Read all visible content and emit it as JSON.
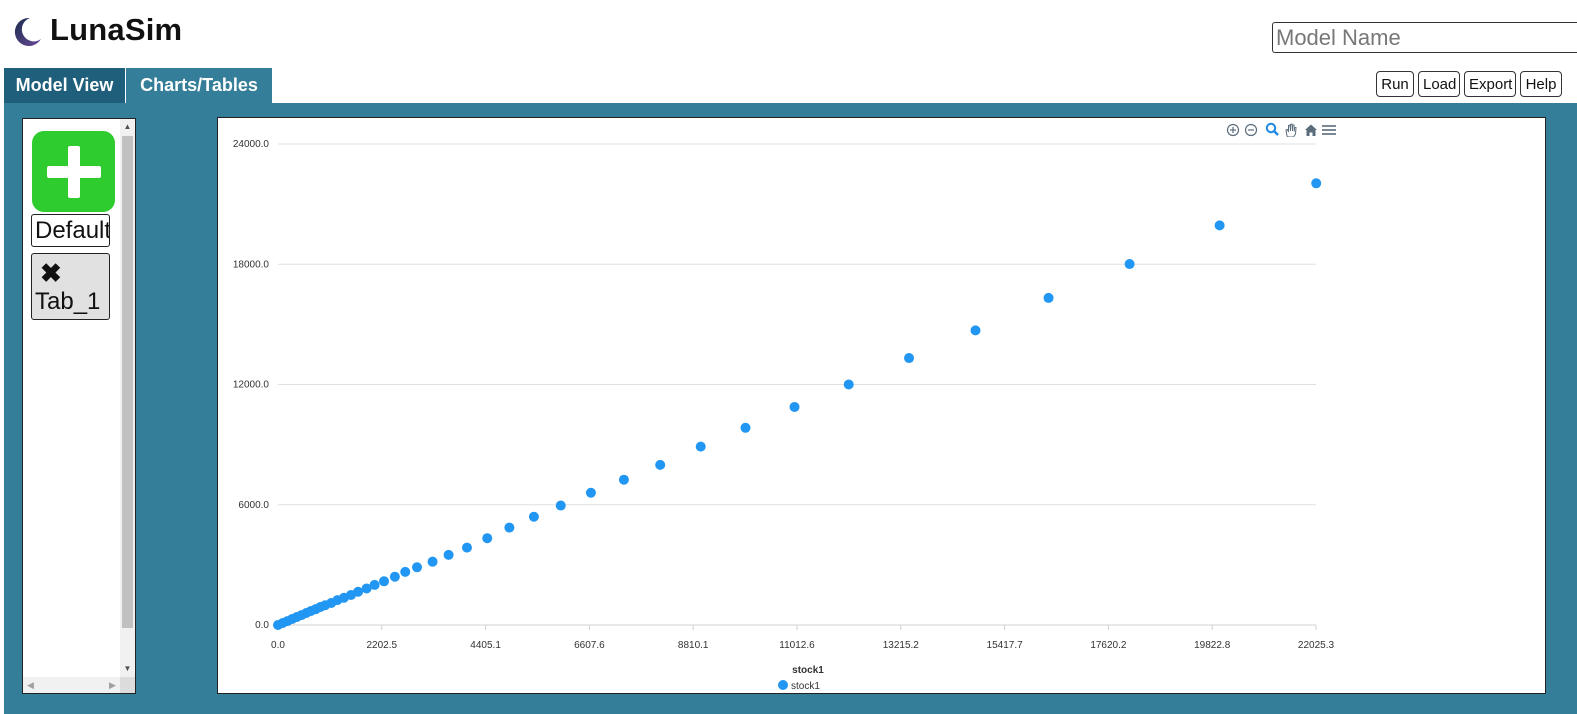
{
  "app": {
    "title": "LunaSim",
    "logo_icon": "crescent-moon-icon",
    "model_name_placeholder": "Model Name"
  },
  "tabs": [
    {
      "label": "Model View",
      "active": false
    },
    {
      "label": "Charts/Tables",
      "active": true
    }
  ],
  "toolbar": {
    "run_label": "Run",
    "load_label": "Load",
    "export_label": "Export",
    "help_label": "Help"
  },
  "sidebar": {
    "add_icon": "plus-icon",
    "default_label": "Default",
    "close_icon": "x-icon",
    "tab1_label": "Tab_1"
  },
  "chart_toolbar": {
    "icons": [
      "zoom-in-icon",
      "zoom-out-icon",
      "zoom-select-icon",
      "pan-hand-icon",
      "reset-home-icon",
      "menu-icon"
    ]
  },
  "colors": {
    "accent": "#357e99",
    "tab_active": "#1f5f7b",
    "add_green": "#2ecc2e",
    "series": "#2196f3"
  },
  "chart_data": {
    "type": "scatter",
    "title": "",
    "xlabel": "stock1",
    "ylabel": "",
    "xlim": [
      0.0,
      22025.3
    ],
    "ylim": [
      0.0,
      24000.0
    ],
    "x_ticks": [
      "0.0",
      "2202.5",
      "4405.1",
      "6607.6",
      "8810.1",
      "11012.6",
      "13215.2",
      "15417.7",
      "17620.2",
      "19822.8",
      "22025.3"
    ],
    "y_ticks": [
      "0.0",
      "6000.0",
      "12000.0",
      "18000.0",
      "24000.0"
    ],
    "grid": "horizontal",
    "legend_position": "bottom",
    "series": [
      {
        "name": "stock1",
        "points": [
          [
            0,
            0
          ],
          [
            100,
            100
          ],
          [
            200,
            195
          ],
          [
            300,
            300
          ],
          [
            400,
            400
          ],
          [
            500,
            495
          ],
          [
            600,
            600
          ],
          [
            700,
            700
          ],
          [
            800,
            790
          ],
          [
            900,
            900
          ],
          [
            1000,
            985
          ],
          [
            1130,
            1100
          ],
          [
            1260,
            1240
          ],
          [
            1400,
            1360
          ],
          [
            1550,
            1500
          ],
          [
            1700,
            1660
          ],
          [
            1880,
            1820
          ],
          [
            2050,
            2000
          ],
          [
            2250,
            2180
          ],
          [
            2480,
            2410
          ],
          [
            2700,
            2650
          ],
          [
            2950,
            2880
          ],
          [
            3280,
            3160
          ],
          [
            3620,
            3500
          ],
          [
            4010,
            3860
          ],
          [
            4440,
            4330
          ],
          [
            4910,
            4860
          ],
          [
            5430,
            5400
          ],
          [
            6000,
            5960
          ],
          [
            6640,
            6600
          ],
          [
            7340,
            7250
          ],
          [
            8110,
            7990
          ],
          [
            8970,
            8900
          ],
          [
            9920,
            9840
          ],
          [
            10960,
            10880
          ],
          [
            12110,
            12000
          ],
          [
            13390,
            13320
          ],
          [
            14800,
            14700
          ],
          [
            16350,
            16320
          ],
          [
            18070,
            18010
          ],
          [
            19980,
            19940
          ],
          [
            22030,
            22040
          ]
        ]
      }
    ]
  }
}
